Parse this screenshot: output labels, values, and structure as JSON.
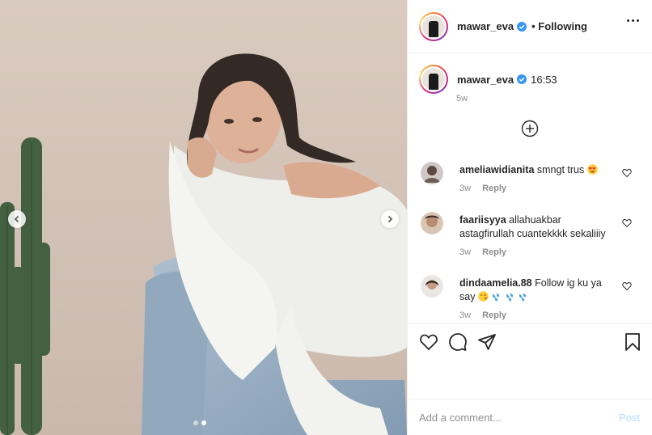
{
  "post": {
    "username": "mawar_eva",
    "follow_status": "Following",
    "caption_time": "16:53",
    "caption_age": "5w",
    "carousel": {
      "total_slides": 2,
      "active_slide": 2
    }
  },
  "comments": [
    {
      "username": "ameliawidianita",
      "text": "smngt trus",
      "emoji": "heart-eyes-emoji",
      "age": "3w",
      "reply_label": "Reply"
    },
    {
      "username": "faariisyya",
      "text": "allahuakbar astagfirullah cuantekkkk sekaliiiy",
      "age": "3w",
      "reply_label": "Reply"
    },
    {
      "username": "dindaamelia.88",
      "text": "Follow ig ku ya say",
      "emoji": "wink-kiss-emoji, sweat-drops-emoji x3",
      "age": "3w",
      "reply_label": "Reply"
    }
  ],
  "composer": {
    "placeholder": "Add a comment...",
    "post_label": "Post"
  },
  "colors": {
    "text": "#262626",
    "muted": "#8e8e8e",
    "post_disabled": "#b3dbff",
    "verified": "#3897f0"
  }
}
